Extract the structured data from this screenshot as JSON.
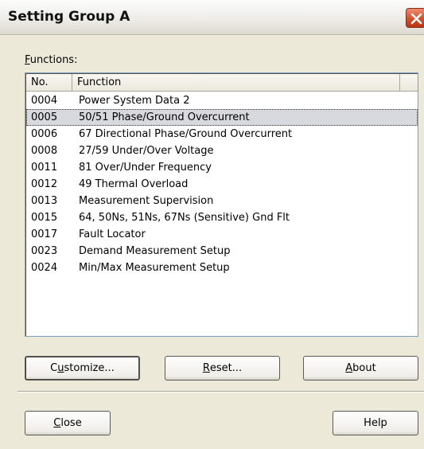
{
  "window": {
    "title": "Setting Group A"
  },
  "functions_label": {
    "mnemonic": "F",
    "rest": "unctions:"
  },
  "list": {
    "columns": [
      "No.",
      "Function"
    ],
    "rows": [
      {
        "no": "0004",
        "function": "Power System Data 2"
      },
      {
        "no": "0005",
        "function": "50/51 Phase/Ground Overcurrent",
        "selected": true
      },
      {
        "no": "0006",
        "function": "67 Directional Phase/Ground Overcurrent"
      },
      {
        "no": "0008",
        "function": "27/59 Under/Over Voltage"
      },
      {
        "no": "0011",
        "function": "81 Over/Under Frequency"
      },
      {
        "no": "0012",
        "function": "49 Thermal Overload"
      },
      {
        "no": "0013",
        "function": "Measurement Supervision"
      },
      {
        "no": "0015",
        "function": "64, 50Ns, 51Ns, 67Ns (Sensitive) Gnd Flt"
      },
      {
        "no": "0017",
        "function": "Fault Locator"
      },
      {
        "no": "0023",
        "function": "Demand Measurement Setup"
      },
      {
        "no": "0024",
        "function": "Min/Max Measurement Setup"
      }
    ]
  },
  "buttons": {
    "customize": {
      "pre": "C",
      "mn": "u",
      "post": "stomize..."
    },
    "reset": {
      "pre": "",
      "mn": "R",
      "post": "eset..."
    },
    "about": {
      "pre": "",
      "mn": "A",
      "post": "bout"
    },
    "close": {
      "pre": "",
      "mn": "C",
      "post": "lose"
    },
    "help": {
      "label": "Help"
    }
  },
  "icons": {
    "close": "close-x-icon"
  },
  "colors": {
    "selection": "#d8d8df",
    "close_button": "#d4512c",
    "dialog_bg": "#ece9d8"
  }
}
